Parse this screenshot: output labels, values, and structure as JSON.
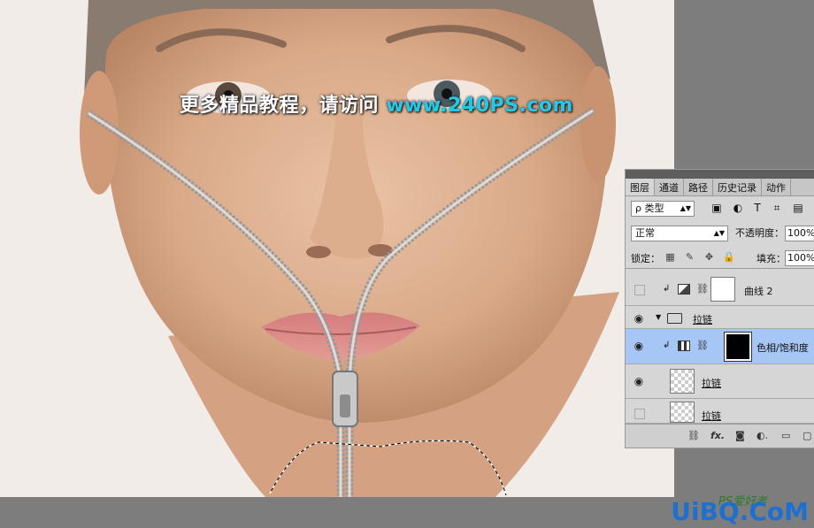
{
  "watermark": {
    "text": "更多精品教程，请访问",
    "url": "www.240PS.com"
  },
  "panel": {
    "tabs": [
      "图层",
      "通道",
      "路径",
      "历史记录",
      "动作"
    ],
    "filter": {
      "label": "ρ 类型"
    },
    "blend_mode": "正常",
    "opacity_label": "不透明度：",
    "opacity_value": "100%",
    "lock_label": "锁定：",
    "fill_label": "填充：",
    "fill_value": "100%",
    "layers": [
      {
        "name": "曲线 2",
        "visible": false
      },
      {
        "name": "拉链",
        "type": "group",
        "visible": true
      },
      {
        "name": "色相/饱和度",
        "visible": true,
        "selected": true
      },
      {
        "name": "拉链",
        "visible": true
      },
      {
        "name": "拉链",
        "visible": false
      }
    ]
  },
  "logo": {
    "text": "UiBQ.CoM",
    "ps_text": "PS爱好者"
  },
  "colors": {
    "accent_url": "#25c9e8",
    "selected_layer": "#a6c6f5",
    "logo": "#1d6fd2"
  }
}
